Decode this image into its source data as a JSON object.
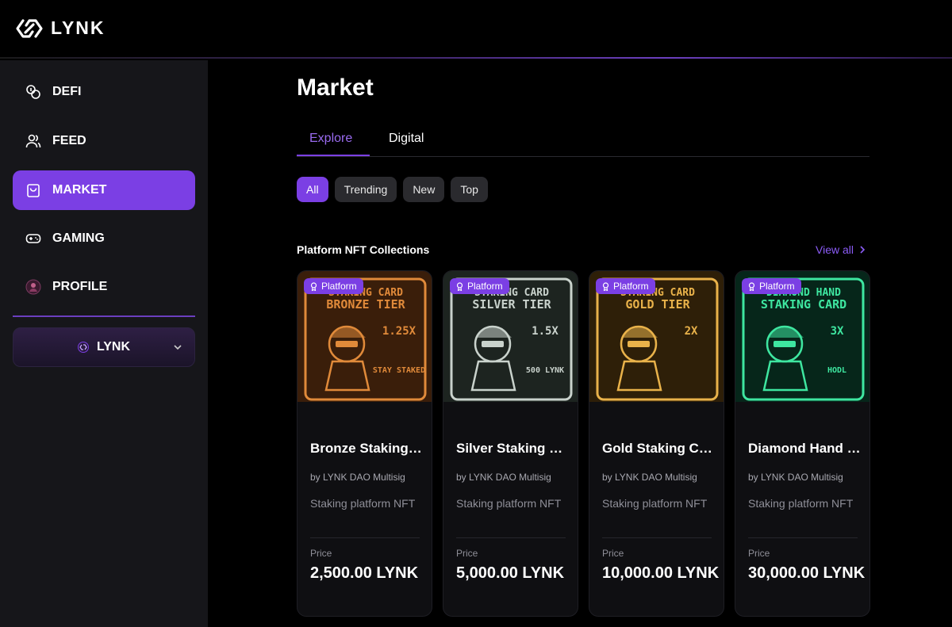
{
  "app": {
    "logo_text": "LYNK"
  },
  "sidebar": {
    "items": [
      {
        "label": "DEFI",
        "icon": "coins-icon",
        "active": false
      },
      {
        "label": "FEED",
        "icon": "users-icon",
        "active": false
      },
      {
        "label": "MARKET",
        "icon": "shopping-bag-icon",
        "active": true
      },
      {
        "label": "GAMING",
        "icon": "gamepad-icon",
        "active": false
      },
      {
        "label": "PROFILE",
        "icon": "profile-avatar-icon",
        "active": false
      }
    ],
    "wallet": {
      "label": "LYNK",
      "icon": "lynk-coin-icon"
    }
  },
  "main": {
    "title": "Market",
    "tabs": [
      {
        "label": "Explore",
        "active": true
      },
      {
        "label": "Digital",
        "active": false
      }
    ],
    "filters": [
      {
        "label": "All",
        "active": true
      },
      {
        "label": "Trending",
        "active": false
      },
      {
        "label": "New",
        "active": false
      },
      {
        "label": "Top",
        "active": false
      }
    ],
    "section": {
      "title": "Platform NFT Collections",
      "view_all": "View all"
    },
    "cards": [
      {
        "badge": "Platform",
        "name": "Bronze Staking Card",
        "by": "by LYNK DAO Multisig",
        "desc": "Staking platform NFT",
        "price_label": "Price",
        "price": "2,500.00 LYNK",
        "art": {
          "top": "STAKING CARD",
          "tier": "BRONZE TIER",
          "multiplier": "1.25X",
          "extra": "STAY STAKED",
          "color": "#e08a3a",
          "bg": "#3a1e0a"
        }
      },
      {
        "badge": "Platform",
        "name": "Silver Staking Card",
        "by": "by LYNK DAO Multisig",
        "desc": "Staking platform NFT",
        "price_label": "Price",
        "price": "5,000.00 LYNK",
        "art": {
          "top": "STAKING CARD",
          "tier": "SILVER TIER",
          "multiplier": "1.5X",
          "extra": "500 LYNK",
          "color": "#c9d2cc",
          "bg": "#1d2420"
        }
      },
      {
        "badge": "Platform",
        "name": "Gold Staking Card",
        "by": "by LYNK DAO Multisig",
        "desc": "Staking platform NFT",
        "price_label": "Price",
        "price": "10,000.00 LYNK",
        "art": {
          "top": "STAKING CARD",
          "tier": "GOLD TIER",
          "multiplier": "2X",
          "extra": "",
          "color": "#e9b24a",
          "bg": "#2e1f08"
        }
      },
      {
        "badge": "Platform",
        "name": "Diamond Hand Staking Card",
        "by": "by LYNK DAO Multisig",
        "desc": "Staking platform NFT",
        "price_label": "Price",
        "price": "30,000.00 LYNK",
        "art": {
          "top": "DIAMOND HAND",
          "tier": "STAKING CARD",
          "multiplier": "3X",
          "extra": "HODL",
          "color": "#3ee6a0",
          "bg": "#06261a"
        }
      }
    ]
  },
  "colors": {
    "accent": "#7b3fe4",
    "link": "#8b5cf6",
    "sidebar_bg": "#16161a"
  }
}
